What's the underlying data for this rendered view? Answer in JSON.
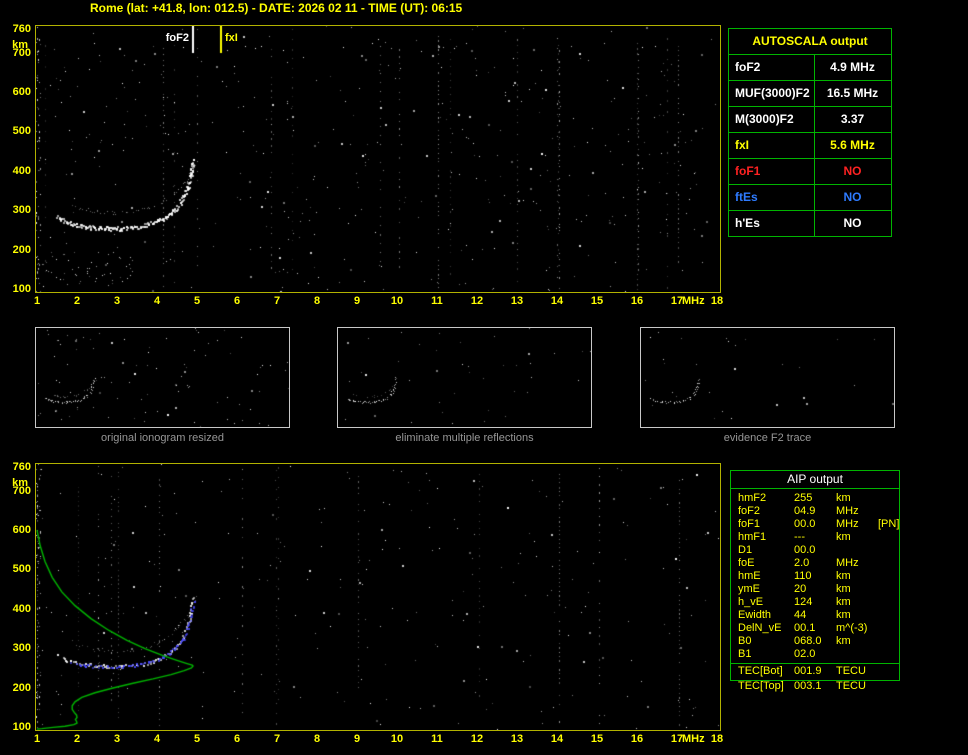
{
  "header": {
    "title": "Rome (lat: +41.8, lon: 012.5) - DATE: 2026 02 11 - TIME (UT): 06:15"
  },
  "autoscala": {
    "title": "AUTOSCALA output",
    "rows": [
      {
        "param": "foF2",
        "value": "4.9 MHz",
        "color": "#ffffff"
      },
      {
        "param": "MUF(3000)F2",
        "value": "16.5 MHz",
        "color": "#ffffff"
      },
      {
        "param": "M(3000)F2",
        "value": "3.37",
        "color": "#ffffff"
      },
      {
        "param": "fxI",
        "value": "5.6 MHz",
        "color": "#ffff00"
      },
      {
        "param": "foF1",
        "value": "NO",
        "color": "#ff2222"
      },
      {
        "param": "ftEs",
        "value": "NO",
        "color": "#2e7bff"
      },
      {
        "param": "h'Es",
        "value": "NO",
        "color": "#ffffff"
      }
    ]
  },
  "thumbnails": [
    {
      "caption": "original ionogram resized"
    },
    {
      "caption": "eliminate multiple reflections"
    },
    {
      "caption": "evidence F2 trace"
    }
  ],
  "aip": {
    "title": "AIP output",
    "rows": [
      {
        "param": "hmF2",
        "value": "255",
        "unit": "km",
        "note": ""
      },
      {
        "param": "foF2",
        "value": "04.9",
        "unit": "MHz",
        "note": ""
      },
      {
        "param": "foF1",
        "value": "00.0",
        "unit": "MHz",
        "note": "[PN]"
      },
      {
        "param": "hmF1",
        "value": "---",
        "unit": "km",
        "note": ""
      },
      {
        "param": "D1",
        "value": "00.0",
        "unit": "",
        "note": ""
      },
      {
        "param": "foE",
        "value": "2.0",
        "unit": "MHz",
        "note": ""
      },
      {
        "param": "hmE",
        "value": "110",
        "unit": "km",
        "note": ""
      },
      {
        "param": "ymE",
        "value": "20",
        "unit": "km",
        "note": ""
      },
      {
        "param": "h_vE",
        "value": "124",
        "unit": "km",
        "note": ""
      },
      {
        "param": "Ewidth",
        "value": "44",
        "unit": "km",
        "note": ""
      },
      {
        "param": "DelN_vE",
        "value": "00.1",
        "unit": "m^(-3)",
        "note": ""
      },
      {
        "param": "B0",
        "value": "068.0",
        "unit": "km",
        "note": ""
      },
      {
        "param": "B1",
        "value": "02.0",
        "unit": "",
        "note": ""
      }
    ],
    "tec_rows": [
      {
        "param": "TEC[Bot]",
        "value": "001.9",
        "unit": "TECU",
        "note": ""
      },
      {
        "param": "TEC[Top]",
        "value": "003.1",
        "unit": "TECU",
        "note": ""
      }
    ]
  },
  "chart_data": [
    {
      "type": "scatter",
      "title": "ionogram",
      "xlabel": "MHz",
      "ylabel": "km",
      "xlim": [
        1,
        18.15
      ],
      "ylim": [
        100,
        760
      ],
      "x_ticks": [
        1,
        2,
        3,
        4,
        5,
        6,
        7,
        8,
        9,
        10,
        11,
        12,
        13,
        14,
        15,
        16,
        17,
        18
      ],
      "y_ticks": [
        760,
        700,
        600,
        500,
        400,
        300,
        200,
        100
      ],
      "grid": false,
      "markers": [
        {
          "label": "foF2",
          "x": 4.9,
          "color": "#ffffff"
        },
        {
          "label": "fxI",
          "x": 5.6,
          "color": "#ffff00"
        }
      ],
      "series": [
        {
          "name": "F2-trace-main",
          "color": "#ffffff",
          "points": [
            [
              1.5,
              285
            ],
            [
              1.7,
              272
            ],
            [
              1.95,
              264
            ],
            [
              2.3,
              258
            ],
            [
              2.7,
              255
            ],
            [
              3.1,
              255
            ],
            [
              3.5,
              259
            ],
            [
              3.9,
              268
            ],
            [
              4.2,
              282
            ],
            [
              4.45,
              302
            ],
            [
              4.62,
              328
            ],
            [
              4.75,
              358
            ],
            [
              4.83,
              392
            ],
            [
              4.88,
              428
            ]
          ]
        },
        {
          "name": "F2-trace-secondary",
          "color": "#ffffff",
          "points": [
            [
              1.9,
              310
            ],
            [
              2.4,
              298
            ],
            [
              2.9,
              293
            ],
            [
              3.4,
              296
            ],
            [
              3.8,
              306
            ],
            [
              4.15,
              322
            ],
            [
              4.45,
              345
            ],
            [
              4.7,
              372
            ],
            [
              4.88,
              402
            ],
            [
              5.0,
              432
            ]
          ]
        }
      ]
    },
    {
      "type": "scatter",
      "title": "profilogram",
      "xlabel": "MHz",
      "ylabel": "km",
      "xlim": [
        1,
        18.15
      ],
      "ylim": [
        100,
        760
      ],
      "x_ticks": [
        1,
        2,
        3,
        4,
        5,
        6,
        7,
        8,
        9,
        10,
        11,
        12,
        13,
        14,
        15,
        16,
        17,
        18
      ],
      "y_ticks": [
        760,
        700,
        600,
        500,
        400,
        300,
        200,
        100
      ],
      "grid": false,
      "series": [
        {
          "name": "measured-trace",
          "color": "#ffffff",
          "points": [
            [
              1.5,
              285
            ],
            [
              1.7,
              272
            ],
            [
              1.95,
              264
            ],
            [
              2.3,
              258
            ],
            [
              2.7,
              255
            ],
            [
              3.1,
              255
            ],
            [
              3.5,
              259
            ],
            [
              3.9,
              268
            ],
            [
              4.2,
              282
            ],
            [
              4.45,
              302
            ],
            [
              4.62,
              328
            ],
            [
              4.75,
              358
            ],
            [
              4.83,
              392
            ],
            [
              4.88,
              428
            ]
          ]
        },
        {
          "name": "secondary-trace",
          "color": "#ffffff",
          "points": [
            [
              1.9,
              310
            ],
            [
              2.4,
              298
            ],
            [
              2.9,
              293
            ],
            [
              3.4,
              296
            ],
            [
              3.8,
              306
            ],
            [
              4.15,
              322
            ],
            [
              4.45,
              345
            ],
            [
              4.7,
              372
            ],
            [
              4.88,
              402
            ],
            [
              5.0,
              432
            ]
          ]
        },
        {
          "name": "restored-trace",
          "color": "#4444ff",
          "points": [
            [
              1.85,
              262
            ],
            [
              2.2,
              257
            ],
            [
              2.6,
              254
            ],
            [
              3.0,
              254
            ],
            [
              3.4,
              258
            ],
            [
              3.8,
              266
            ],
            [
              4.15,
              280
            ],
            [
              4.45,
              300
            ],
            [
              4.65,
              326
            ],
            [
              4.78,
              358
            ],
            [
              4.86,
              395
            ],
            [
              4.9,
              420
            ]
          ]
        },
        {
          "name": "electron-density-profile",
          "color": "#00b400",
          "points": [
            [
              1.0,
              600
            ],
            [
              1.08,
              560
            ],
            [
              1.2,
              520
            ],
            [
              1.38,
              480
            ],
            [
              1.62,
              443
            ],
            [
              1.95,
              408
            ],
            [
              2.35,
              375
            ],
            [
              2.8,
              345
            ],
            [
              3.25,
              320
            ],
            [
              3.7,
              299
            ],
            [
              4.15,
              281
            ],
            [
              4.5,
              269
            ],
            [
              4.75,
              261
            ],
            [
              4.88,
              257
            ],
            [
              4.9,
              255
            ],
            [
              4.86,
              250
            ],
            [
              4.68,
              243
            ],
            [
              4.35,
              233
            ],
            [
              3.9,
              222
            ],
            [
              3.4,
              211
            ],
            [
              2.9,
              199
            ],
            [
              2.45,
              187
            ],
            [
              2.12,
              175
            ],
            [
              1.95,
              164
            ],
            [
              1.88,
              154
            ],
            [
              1.88,
              145
            ],
            [
              1.93,
              137
            ],
            [
              1.99,
              130
            ],
            [
              2.0,
              124
            ],
            [
              1.96,
              119
            ],
            [
              1.99,
              114
            ],
            [
              2.0,
              110
            ],
            [
              1.92,
              106
            ],
            [
              1.7,
              102
            ],
            [
              1.4,
              99
            ],
            [
              1.12,
              96
            ],
            [
              1.0,
              95
            ]
          ]
        }
      ]
    }
  ]
}
